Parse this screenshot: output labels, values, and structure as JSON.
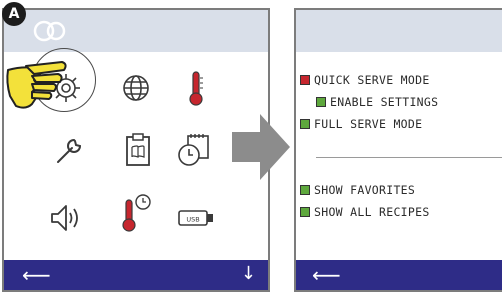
{
  "callout": {
    "label": "A"
  },
  "colors": {
    "nav_bar": "#2e2c87",
    "header_bar": "#d9dfe9",
    "checked_green": "#5ea83d",
    "checked_red": "#c6262e",
    "hand": "#f3e13a"
  },
  "left_screen": {
    "icons": [
      "settings-gear-icon",
      "globe-icon",
      "thermometer-icon",
      "wrench-icon",
      "recipe-book-icon",
      "clock-calendar-icon",
      "speaker-volume-icon",
      "thermometer-alarm-icon",
      "usb-drive-icon"
    ],
    "nav": {
      "back_symbol": "⟵",
      "down_symbol": "↓"
    }
  },
  "right_screen": {
    "items": [
      {
        "label": "QUICK SERVE MODE",
        "state": "red"
      },
      {
        "label": "ENABLE SETTINGS",
        "state": "green"
      },
      {
        "label": "FULL SERVE MODE",
        "state": "green"
      },
      {
        "label": "SHOW FAVORITES",
        "state": "green"
      },
      {
        "label": "SHOW ALL RECIPES",
        "state": "green"
      }
    ],
    "nav": {
      "back_symbol": "⟵"
    }
  }
}
